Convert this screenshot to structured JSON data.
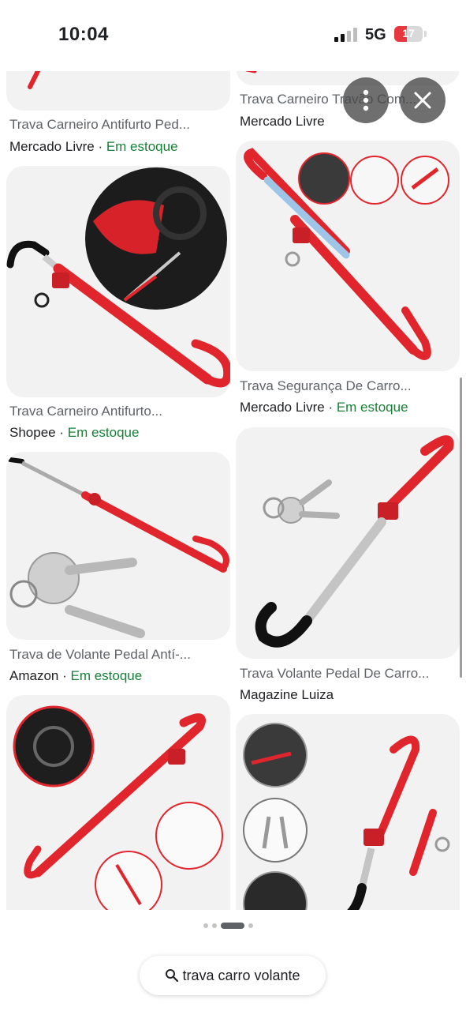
{
  "status": {
    "time": "10:04",
    "network": "5G",
    "battery": "17"
  },
  "results": [
    {
      "title": "Trava Carneiro Antifurto Ped...",
      "source": "Mercado Livre",
      "stock": "Em estoque"
    },
    {
      "title": "Trava Carneiro Travão Com...",
      "source": "Mercado Livre",
      "stock": ""
    },
    {
      "title": "Trava Carneiro Antifurto...",
      "source": "Shopee",
      "stock": "Em estoque"
    },
    {
      "title": "Trava Segurança De Carro...",
      "source": "Mercado Livre",
      "stock": "Em estoque"
    },
    {
      "title": "Trava de Volante Pedal Antí-...",
      "source": "Amazon",
      "stock": "Em estoque"
    },
    {
      "title": "Trava Volante Pedal De Carro...",
      "source": "Magazine Luiza",
      "stock": ""
    }
  ],
  "separator": " · ",
  "search": {
    "query": "trava carro volante"
  },
  "pagination": {
    "count": 4,
    "active": 2
  },
  "colors": {
    "accent_red": "#e0262c",
    "stock_green": "#188038"
  },
  "icons": {
    "more": "more-vert-icon",
    "close": "close-icon",
    "search": "search-icon"
  }
}
